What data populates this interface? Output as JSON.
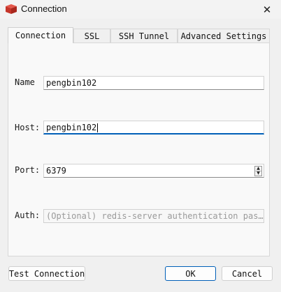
{
  "window": {
    "title": "Connection",
    "icon": "redis-cube-icon",
    "close_glyph": "✕"
  },
  "tabs": [
    {
      "label": "Connection",
      "active": true
    },
    {
      "label": "SSL",
      "active": false
    },
    {
      "label": "SSH Tunnel",
      "active": false
    },
    {
      "label": "Advanced Settings",
      "active": false
    }
  ],
  "form": {
    "name": {
      "label": "Name",
      "value": "pengbin102"
    },
    "host": {
      "label": "Host:",
      "value": "pengbin102"
    },
    "port": {
      "label": "Port:",
      "value": "6379",
      "up_glyph": "▲",
      "down_glyph": "▼"
    },
    "auth": {
      "label": "Auth:",
      "value": "",
      "placeholder": "(Optional) redis-server authentication pas…"
    }
  },
  "buttons": {
    "test_connection": "Test Connection",
    "ok": "OK",
    "cancel": "Cancel"
  },
  "colors": {
    "accent": "#005fb8",
    "icon_red": "#d43b2f"
  }
}
